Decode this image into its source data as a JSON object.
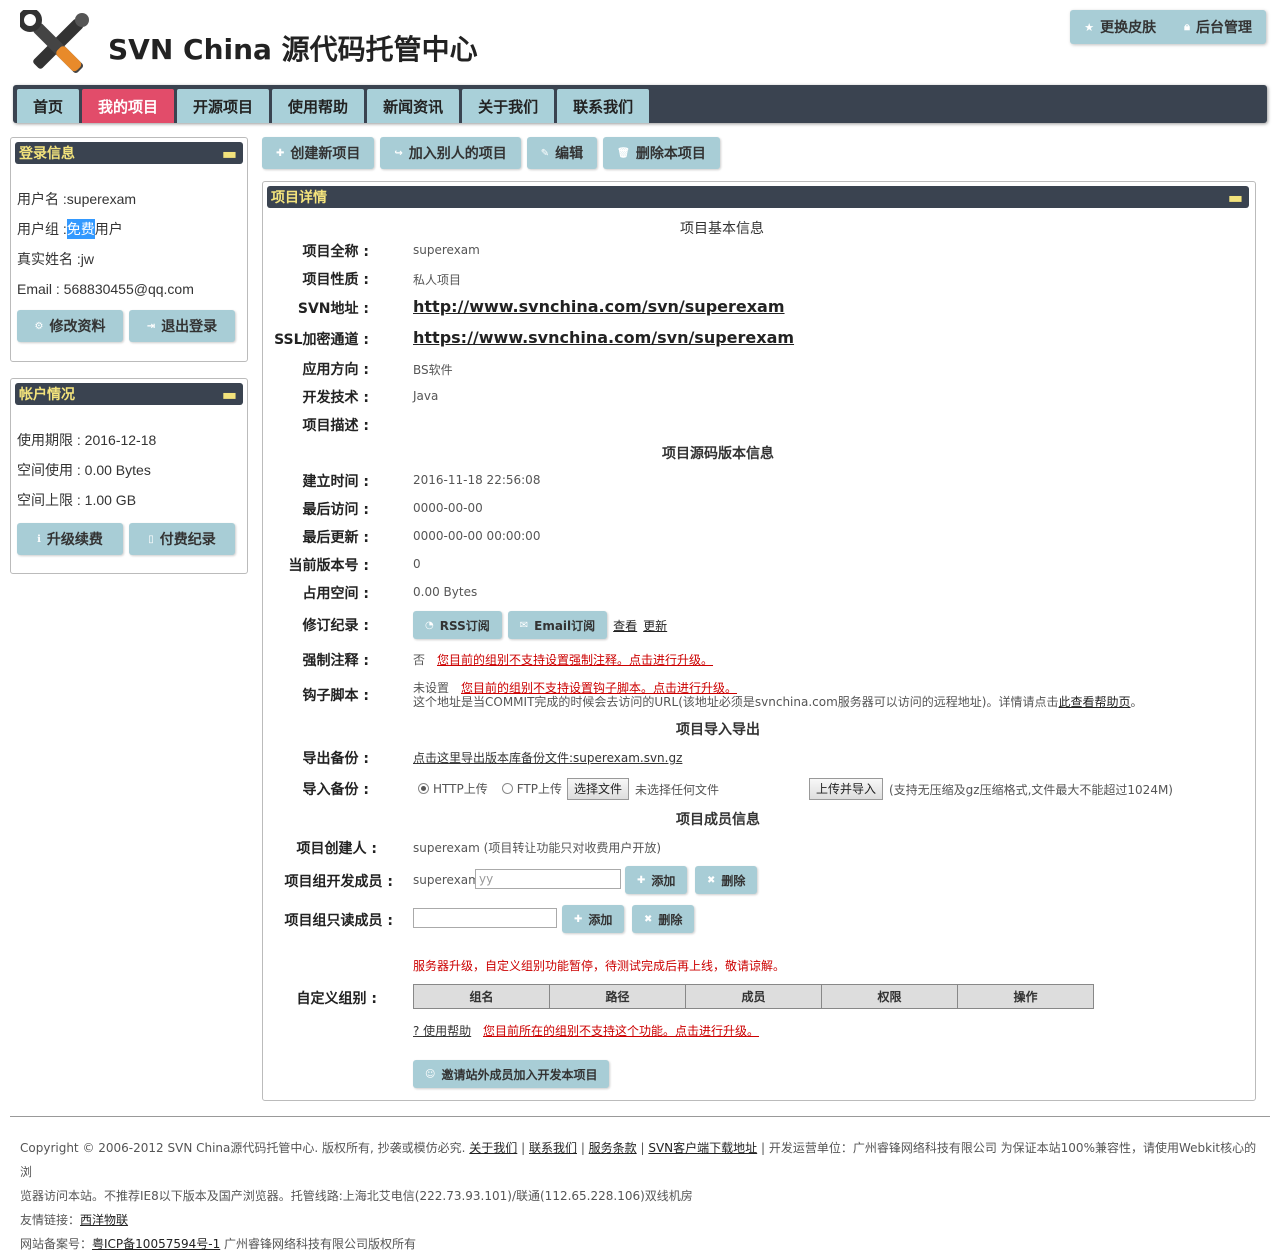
{
  "header": {
    "title": "SVN China 源代码托管中心",
    "skin_label": "更换皮肤",
    "admin_label": "后台管理"
  },
  "nav": {
    "items": [
      "首页",
      "我的项目",
      "开源项目",
      "使用帮助",
      "新闻资讯",
      "关于我们",
      "联系我们"
    ],
    "active": "我的项目"
  },
  "login_panel": {
    "title": "登录信息",
    "username_label": "用户名 : ",
    "username": "superexam",
    "group_label": "用户组 : ",
    "group_selected": "免费",
    "group_rest": "用户",
    "realname": "真实姓名 :jw",
    "email": "Email : 568830455@qq.com",
    "edit_label": "修改资料",
    "logout_label": "退出登录"
  },
  "account_panel": {
    "title": "帐户情况",
    "expire": "使用期限 : 2016-12-18",
    "used": "空间使用 : 0.00 Bytes",
    "limit": "空间上限 : 1.00 GB",
    "upgrade_label": "升级续费",
    "payment_label": "付费纪录"
  },
  "toolbar": {
    "create": "创建新项目",
    "join": "加入别人的项目",
    "edit": "编辑",
    "delete": "删除本项目"
  },
  "detail": {
    "title": "项目详情",
    "basic_title": "项目基本信息",
    "full_name_label": "项目全称 :",
    "full_name": "superexam",
    "nature_label": "项目性质 :",
    "nature": "私人项目",
    "svn_label": "SVN地址 :",
    "svn_url": "http://www.svnchina.com/svn/superexam",
    "ssl_label": "SSL加密通道 :",
    "ssl_url": "https://www.svnchina.com/svn/superexam",
    "direction_label": "应用方向 :",
    "direction": "BS软件",
    "tech_label": "开发技术 :",
    "tech": "Java",
    "desc_label": "项目描述 :",
    "source_title": "项目源码版本信息",
    "created_label": "建立时间 :",
    "created": "2016-11-18 22:56:08",
    "last_access_label": "最后访问 :",
    "last_access": "0000-00-00",
    "last_update_label": "最后更新 :",
    "last_update": "0000-00-00 00:00:00",
    "revision_label": "当前版本号 :",
    "revision": "0",
    "space_label": "占用空间 :",
    "space": "0.00 Bytes",
    "log_label": "修订纪录 :",
    "rss_label": "RSS订阅",
    "email_sub_label": "Email订阅",
    "view_label": "查看",
    "update_label": "更新",
    "force_label": "强制注释 :",
    "force_value": "否",
    "force_warn": "您目前的组别不支持设置强制注释。点击进行升级。",
    "hook_label": "钩子脚本 :",
    "hook_value": "未设置",
    "hook_warn": "您目前的组别不支持设置钩子脚本。点击进行升级。",
    "hook_note": "这个地址是当COMMIT完成的时候会去访问的URL(该地址必须是svnchina.com服务器可以访问的远程地址)。详情请点击",
    "hook_help_link": "此查看帮助页",
    "hook_note_end": "。",
    "io_title": "项目导入导出",
    "export_label": "导出备份 :",
    "export_link": "点击这里导出版本库备份文件:superexam.svn.gz",
    "import_label": "导入备份 :",
    "http_upload": "HTTP上传",
    "ftp_upload": "FTP上传",
    "choose_file": "选择文件",
    "no_file": "未选择任何文件",
    "upload_import": "上传并导入",
    "upload_note": "(支持无压缩及gz压缩格式,文件最大不能超过1024M)",
    "members_title": "项目成员信息",
    "creator_label": "项目创建人 :",
    "creator": "superexam (项目转让功能只对收费用户开放)",
    "dev_label": "项目组开发成员 :",
    "dev_member": "superexam",
    "dev_input": "yy",
    "readonly_label": "项目组只读成员 :",
    "add_label": "添加",
    "delete_label": "删除",
    "server_notice": "服务器升级，自定义组别功能暂停，待测试完成后再上线，敬请谅解。",
    "custom_group_label": "自定义组别 :",
    "group_columns": [
      "组名",
      "路径",
      "成员",
      "权限",
      "操作"
    ],
    "help_link": "? 使用帮助",
    "group_warn": "您目前所在的组别不支持这个功能。点击进行升级。",
    "invite_label": "邀请站外成员加入开发本项目"
  },
  "footer": {
    "copyright": "Copyright © 2006-2012 SVN China源代码托管中心. 版权所有, 抄袭或模仿必究.",
    "about": "关于我们",
    "contact": "联系我们",
    "terms": "服务条款",
    "client": "SVN客户端下载地址",
    "operator": "开发运营单位：广州睿锋网络科技有限公司 为保证本站100%兼容性，请使用Webkit核心的浏",
    "line2": "览器访问本站。不推荐IE8以下版本及国产浏览器。托管线路:上海北艾电信(222.73.93.101)/联通(112.65.228.106)双线机房",
    "friends_label": "友情链接：",
    "friend1": "西洋物联",
    "icp_label": "网站备案号：",
    "icp": "粤ICP备10057594号-1",
    "icp_company": "广州睿锋网络科技有限公司版权所有"
  }
}
